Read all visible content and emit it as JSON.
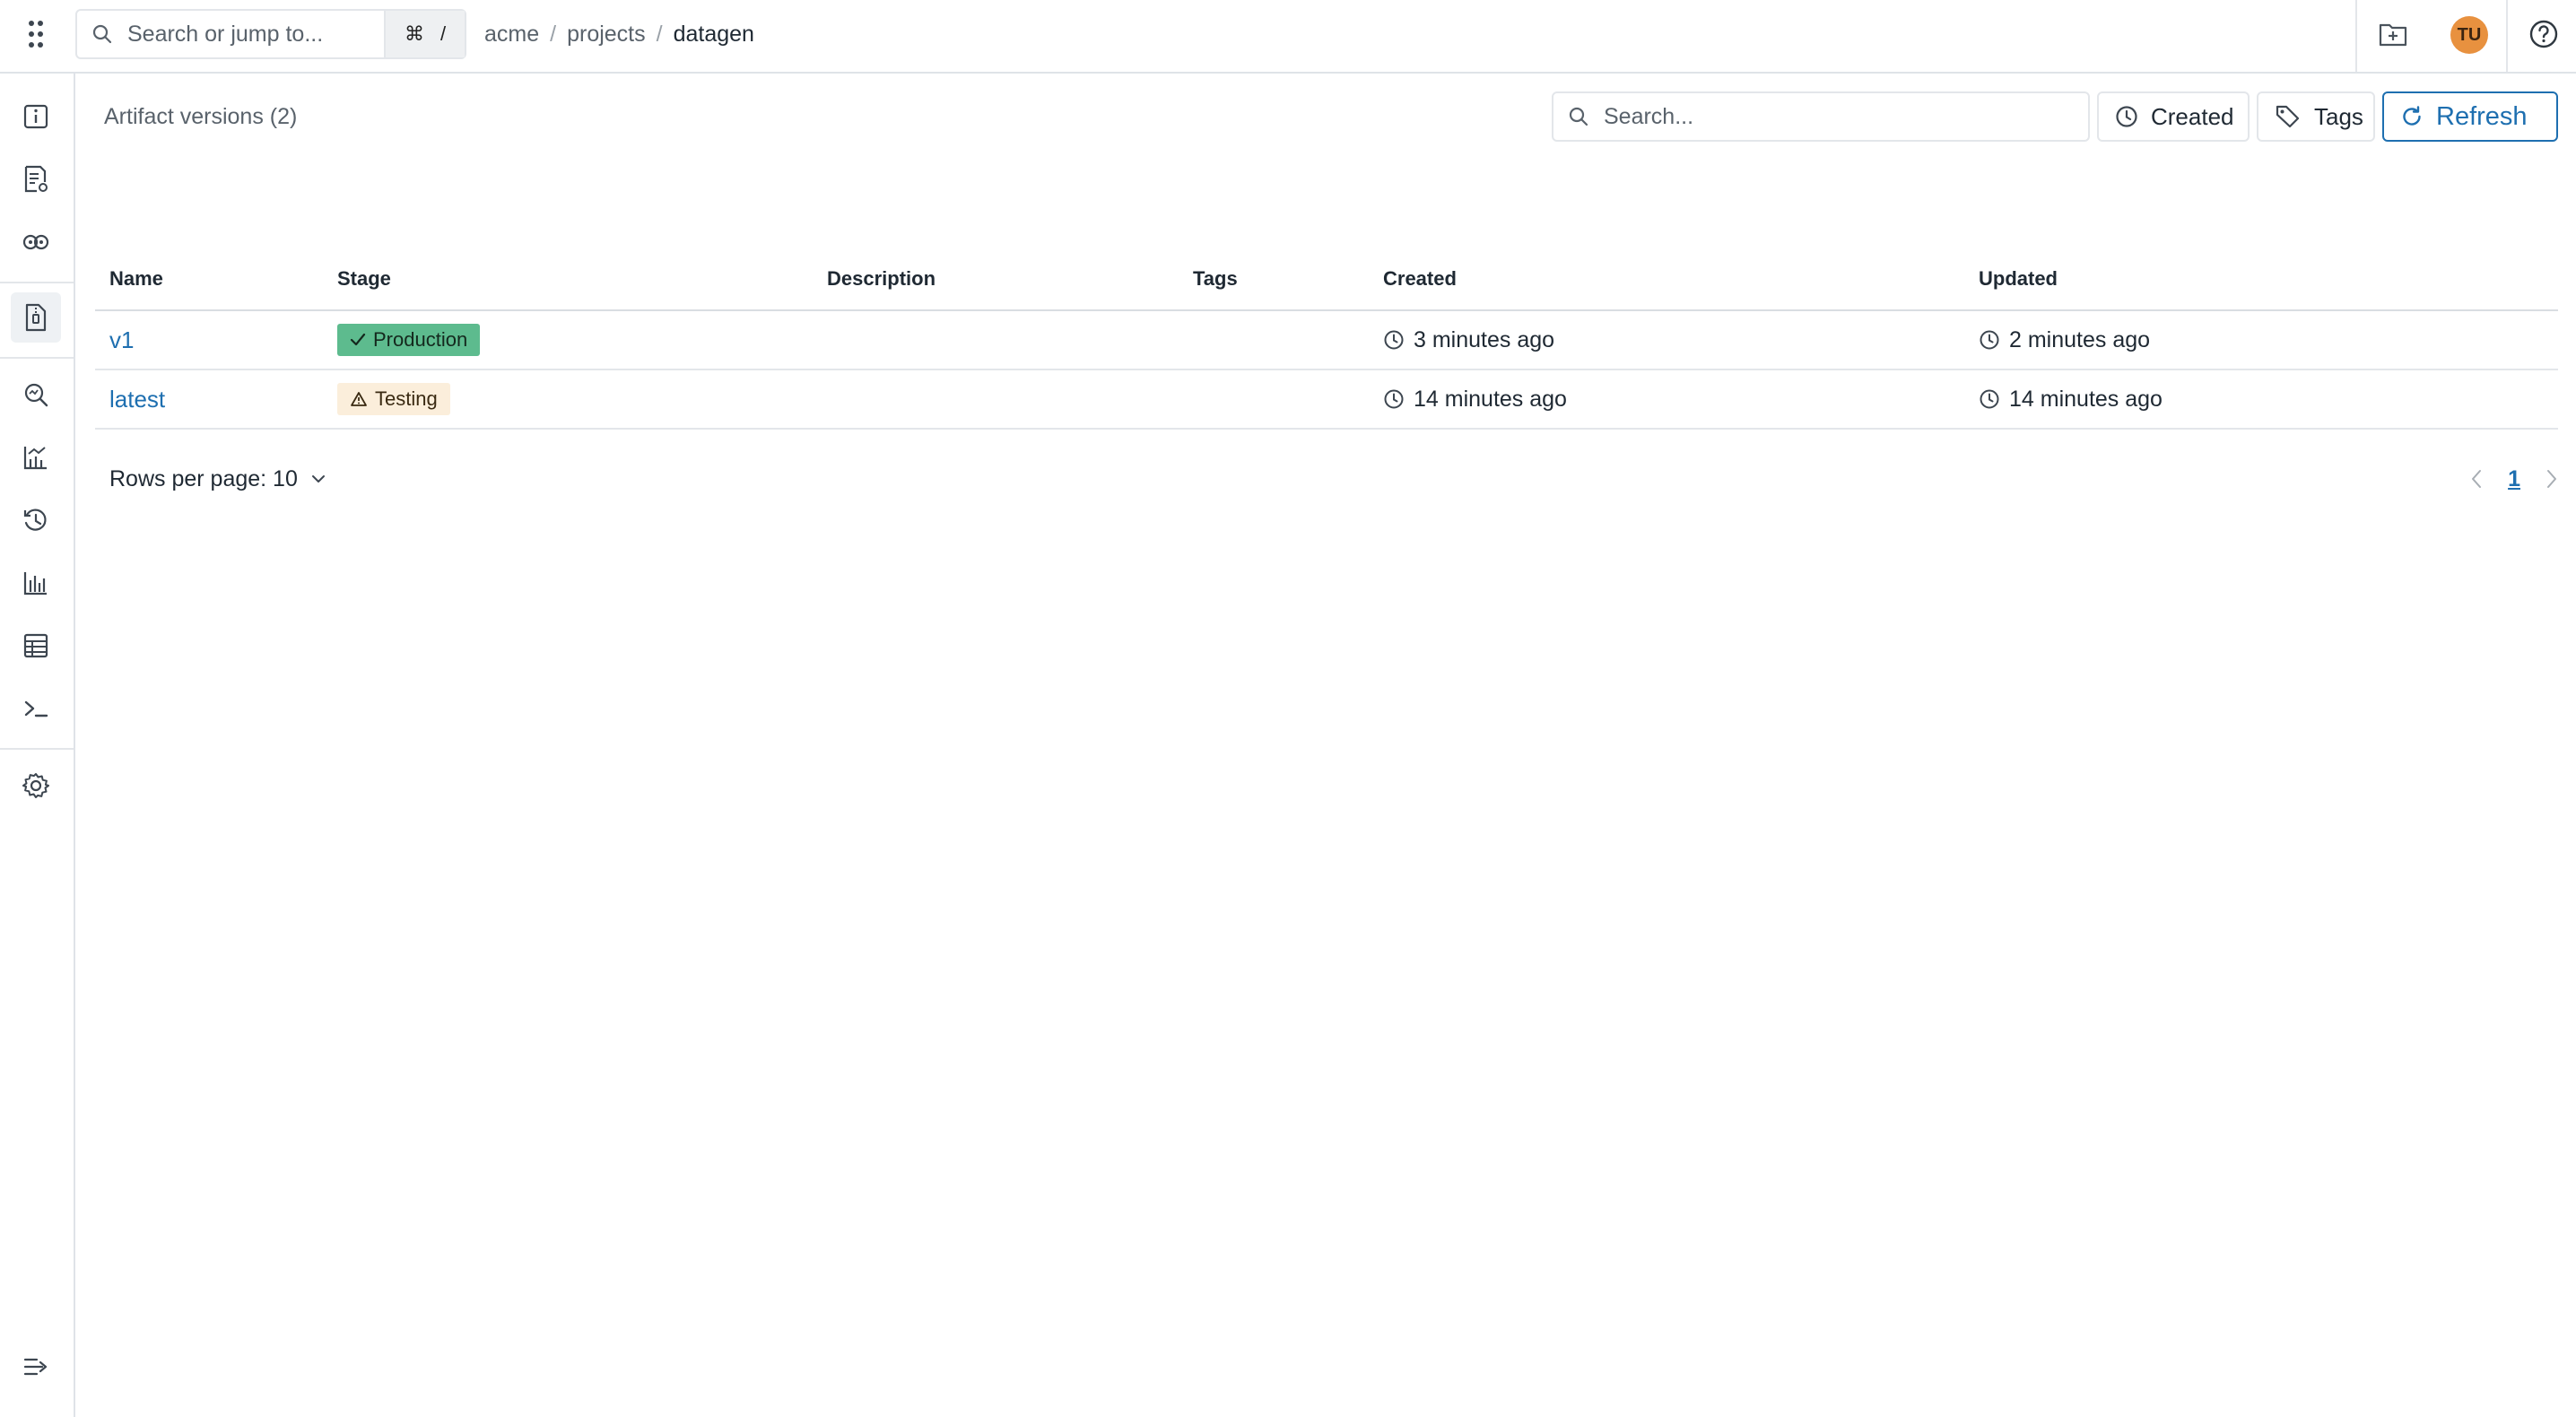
{
  "header": {
    "search_placeholder": "Search or jump to...",
    "shortcut_cmd": "⌘",
    "shortcut_key": "/",
    "breadcrumbs": [
      "acme",
      "projects",
      "datagen"
    ],
    "avatar_initials": "TU"
  },
  "sidebar": {
    "items": [
      {
        "icon": "info-icon"
      },
      {
        "icon": "document-settings-icon"
      },
      {
        "icon": "model-icon"
      },
      {
        "icon": "artifact-icon",
        "active": true
      },
      {
        "icon": "explore-icon"
      },
      {
        "icon": "analytics-icon"
      },
      {
        "icon": "history-icon"
      },
      {
        "icon": "bar-chart-icon"
      },
      {
        "icon": "table-icon"
      },
      {
        "icon": "terminal-icon"
      },
      {
        "icon": "gear-icon"
      }
    ],
    "collapse_icon": "expand-sidebar-icon"
  },
  "main": {
    "title": "Artifact versions (2)",
    "search_placeholder": "Search...",
    "filter_created": "Created",
    "filter_tags": "Tags",
    "refresh": "Refresh",
    "columns": [
      "Name",
      "Stage",
      "Description",
      "Tags",
      "Created",
      "Updated"
    ],
    "rows": [
      {
        "name": "v1",
        "stage": "Production",
        "stage_kind": "production",
        "description": "",
        "tags": "",
        "created": "3 minutes ago",
        "updated": "2 minutes ago"
      },
      {
        "name": "latest",
        "stage": "Testing",
        "stage_kind": "testing",
        "description": "",
        "tags": "",
        "created": "14 minutes ago",
        "updated": "14 minutes ago"
      }
    ],
    "rows_per_page_label": "Rows per page: 10",
    "current_page": "1"
  },
  "colors": {
    "accent": "#1e6fb0",
    "production_badge": "#5dbb8e",
    "testing_badge": "#fbeedb",
    "avatar": "#e8913f"
  }
}
